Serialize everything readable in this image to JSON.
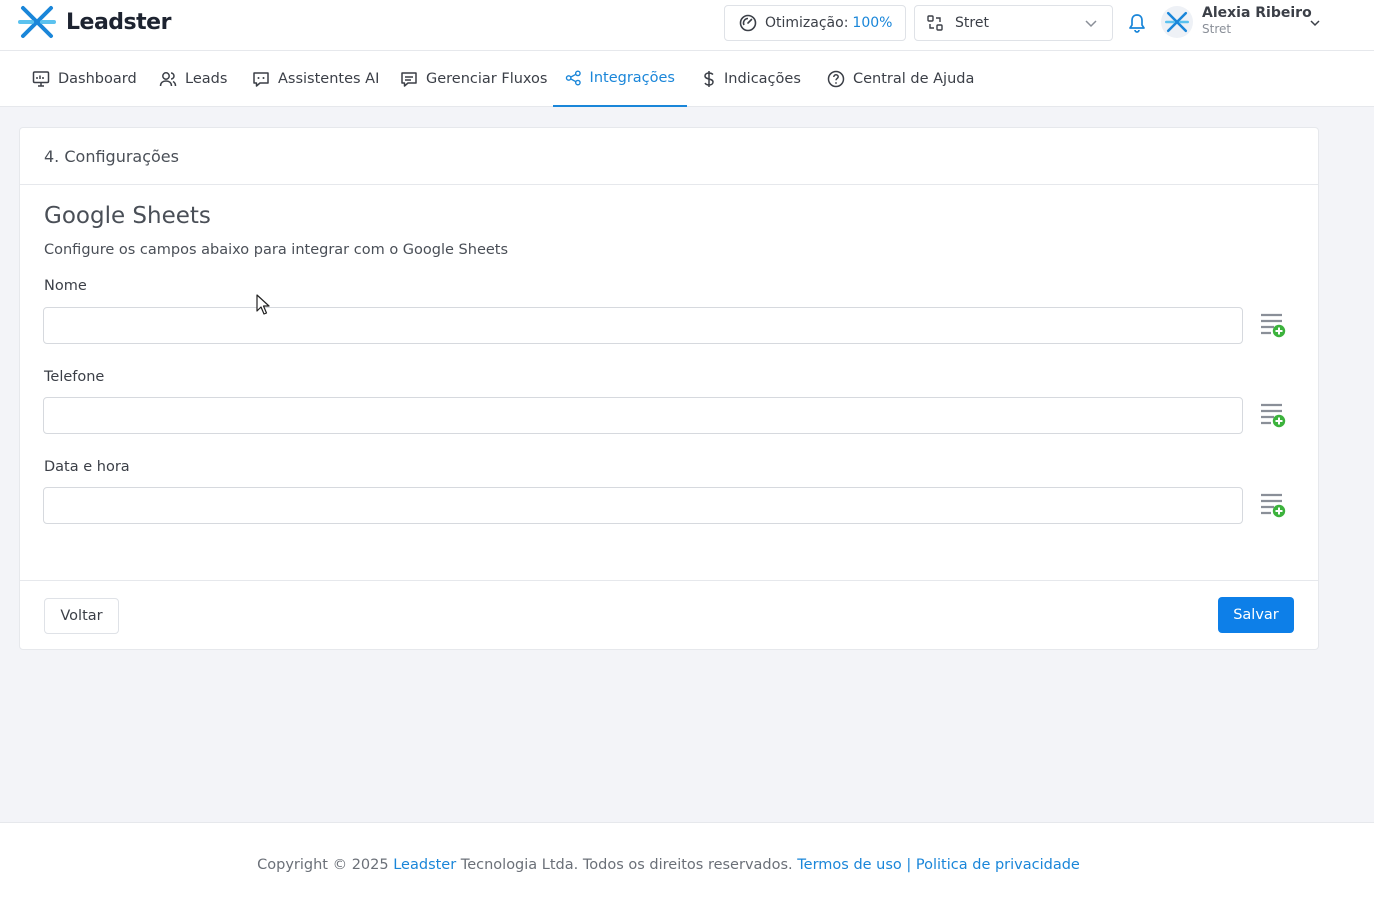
{
  "header": {
    "brand": "Leadster",
    "optimization_label": "Otimização:",
    "optimization_value": "100%",
    "store_name": "Stret",
    "user_name": "Alexia Ribeiro",
    "user_company": "Stret"
  },
  "nav": {
    "items": [
      {
        "label": "Dashboard",
        "icon": "monitor-icon"
      },
      {
        "label": "Leads",
        "icon": "users-icon"
      },
      {
        "label": "Assistentes AI",
        "icon": "chat-bot-icon"
      },
      {
        "label": "Gerenciar Fluxos",
        "icon": "message-square-icon"
      },
      {
        "label": "Integrações",
        "icon": "share-icon",
        "active": true
      },
      {
        "label": "Indicações",
        "icon": "dollar-icon"
      },
      {
        "label": "Central de Ajuda",
        "icon": "help-circle-icon"
      }
    ]
  },
  "card": {
    "step_title": "4. Configurações",
    "section_title": "Google Sheets",
    "section_description": "Configure os campos abaixo para integrar com o Google Sheets",
    "fields": [
      {
        "label": "Nome",
        "value": ""
      },
      {
        "label": "Telefone",
        "value": ""
      },
      {
        "label": "Data e hora",
        "value": ""
      }
    ],
    "back_label": "Voltar",
    "save_label": "Salvar"
  },
  "footer": {
    "copyright_prefix": "Copyright © 2025 ",
    "company_link": "Leadster",
    "copyright_suffix": " Tecnologia Ltda. Todos os direitos reservados. ",
    "terms_link": "Termos de uso",
    "separator": " | ",
    "privacy_link": "Politica de privacidade"
  },
  "colors": {
    "accent": "#1a86d9",
    "primary_button": "#0d7fe8",
    "add_icon_green": "#3cb23c"
  }
}
